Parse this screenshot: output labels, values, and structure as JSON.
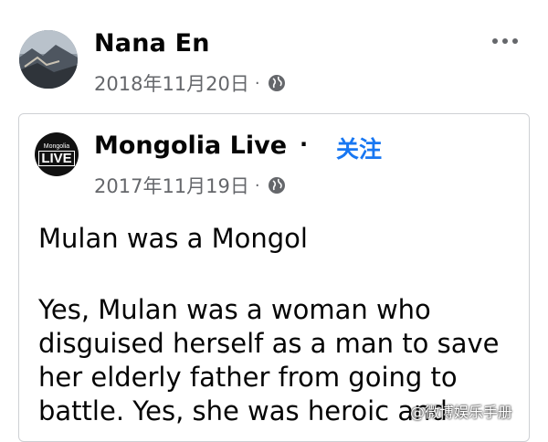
{
  "author": {
    "name": "Nana En",
    "date": "2018年11月20日"
  },
  "shared": {
    "logo_small": "Mongolia",
    "logo_big": "LIVE",
    "page_name": "Mongolia Live",
    "separator": "·",
    "follow_label": "关注",
    "date": "2017年11月19日"
  },
  "meta_separator": "·",
  "post": {
    "title": "Mulan was a Mongol",
    "lines": [
      "Yes, Mulan was a woman who",
      "disguised herself as a man to save",
      "her elderly father from going to",
      "battle. Yes, she was heroic and"
    ]
  },
  "watermark": "@微博娱乐手册",
  "icons": {
    "privacy": "globe-icon",
    "menu": "more-options-icon"
  }
}
